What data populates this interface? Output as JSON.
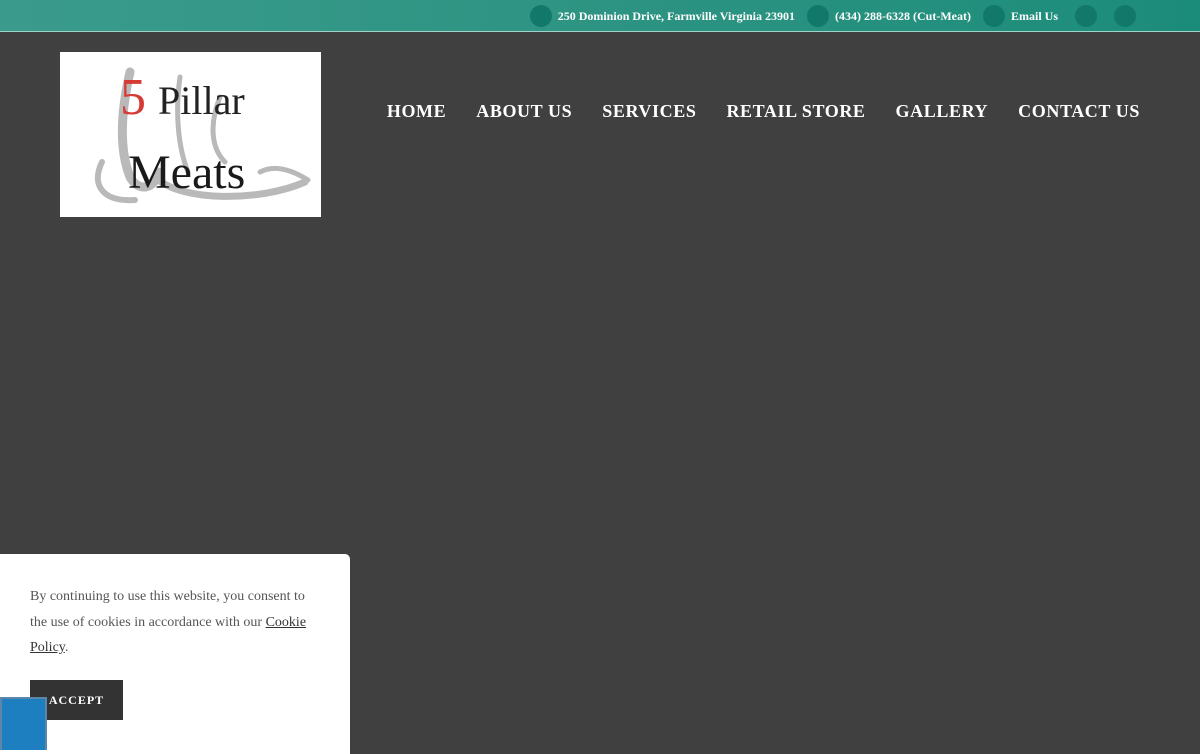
{
  "topbar": {
    "address": "250 Dominion Drive, Farmville Virginia 23901",
    "phone": "(434) 288-6328 (Cut-Meat)",
    "email": "Email Us",
    "address_icon": "map-marker-icon",
    "phone_icon": "phone-icon",
    "email_icon": "envelope-icon",
    "social_icons": [
      "facebook-icon",
      "instagram-icon"
    ]
  },
  "logo": {
    "number": "5",
    "word1": "Pillar",
    "word2": "Meats"
  },
  "nav": {
    "items": [
      "HOME",
      "ABOUT US",
      "SERVICES",
      "RETAIL STORE",
      "GALLERY",
      "CONTACT US"
    ]
  },
  "cookie": {
    "text_before": "By continuing to use this website, you consent to the use of cookies in accordance with our ",
    "link": "Cookie Policy",
    "text_after": ".",
    "accept": "ACCEPT"
  },
  "colors": {
    "topbar": "#2f9483",
    "icon_circle": "#12786a",
    "background": "#404040",
    "logo_red": "#d63a35",
    "accessibility": "#1e7fc0"
  }
}
